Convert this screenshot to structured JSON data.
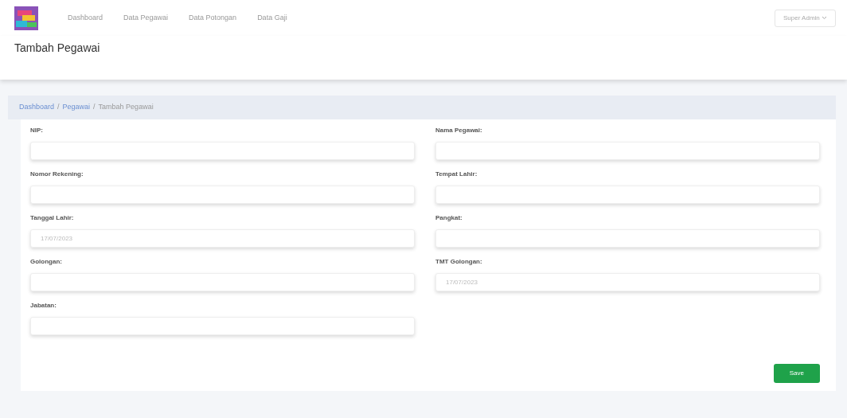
{
  "navbar": {
    "links": [
      {
        "label": "Dashboard"
      },
      {
        "label": "Data Pegawai"
      },
      {
        "label": "Data Potongan"
      },
      {
        "label": "Data Gaji"
      }
    ],
    "user_menu": "Super Admin"
  },
  "page_title": "Tambah Pegawai",
  "breadcrumb_separator": "/",
  "breadcrumb": [
    {
      "label": "Dashboard",
      "kind": "link"
    },
    {
      "label": "Pegawai",
      "kind": "link"
    },
    {
      "label": "Tambah Pegawai",
      "kind": "current"
    }
  ],
  "form": {
    "columns": [
      {
        "fields": [
          {
            "label": "NIP:",
            "kind": "text"
          },
          {
            "label": "Nomor Rekening:",
            "kind": "text"
          },
          {
            "label": "Tanggal Lahir:",
            "kind": "date",
            "value": "17/07/2023"
          },
          {
            "label": "Golongan:",
            "kind": "text"
          },
          {
            "label": "Jabatan:",
            "kind": "text"
          }
        ]
      },
      {
        "fields": [
          {
            "label": "Nama Pegawai:",
            "kind": "text"
          },
          {
            "label": "Tempat Lahir:",
            "kind": "text"
          },
          {
            "label": "Pangkat:",
            "kind": "text"
          },
          {
            "label": "TMT Golongan:",
            "kind": "date",
            "value": "17/07/2023"
          }
        ]
      }
    ],
    "submit": "Save"
  }
}
